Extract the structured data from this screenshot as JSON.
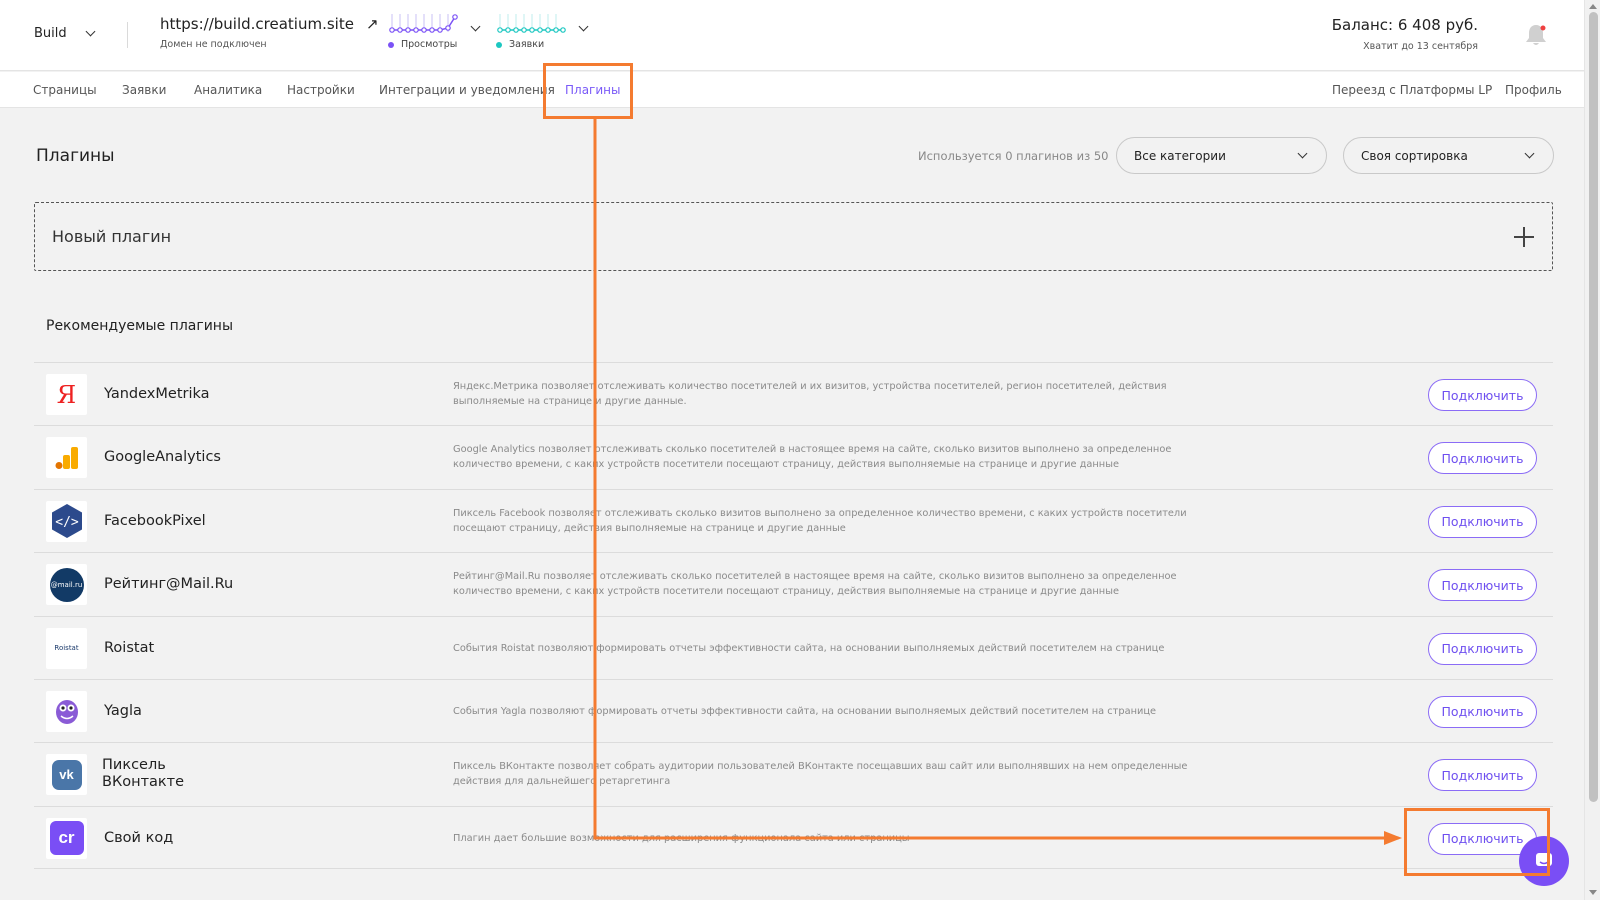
{
  "header": {
    "project": "Build",
    "domain_url": "https://build.creatium.site",
    "domain_status": "Домен не подключен",
    "stats": [
      {
        "label": "Просмотры",
        "color": "#7b52f6"
      },
      {
        "label": "Заявки",
        "color": "#1cc7c1"
      }
    ],
    "balance": "Баланс: 6 408 руб.",
    "balance_note": "Хватит до 13 сентября"
  },
  "nav": {
    "left": [
      "Страницы",
      "Заявки",
      "Аналитика",
      "Настройки",
      "Интеграции и уведомления",
      "Плагины"
    ],
    "right": [
      "Переезд с Платформы LP",
      "Профиль"
    ],
    "active": "Плагины"
  },
  "page": {
    "title": "Плагины",
    "usage": "Используется 0 плагинов из 50",
    "category_select": "Все категории",
    "sort_select": "Своя сортировка",
    "new_plugin": "Новый плагин",
    "recommended_title": "Рекомендуемые плагины"
  },
  "plugins": [
    {
      "name": "YandexMetrika",
      "icon": "yandex-metrika-icon",
      "description": "Яндекс.Метрика позволяет отслеживать количество посетителей и их визитов, устройства посетителей, регион посетителей, действия выполняемые на странице и другие данные.",
      "button": "Подключить"
    },
    {
      "name": "GoogleAnalytics",
      "icon": "google-analytics-icon",
      "description": "Google Analytics позволяет отслеживать сколько посетителей в настоящее время на сайте, сколько визитов выполнено за определенное количество времени, с каких устройств посетители посещают страницу, действия выполняемые на странице и другие данные",
      "button": "Подключить"
    },
    {
      "name": "FacebookPixel",
      "icon": "facebook-pixel-icon",
      "description": "Пиксель Facebook позволяет отслеживать сколько визитов выполнено за определенное количество времени, с каких устройств посетители посещают страницу, действия выполняемые на странице и другие данные",
      "button": "Подключить"
    },
    {
      "name": "Рейтинг@Mail.Ru",
      "icon": "mail-ru-icon",
      "icon_text": "@mail.ru",
      "description": "Рейтинг@Mail.Ru позволяет отслеживать сколько посетителей в настоящее время на сайте, сколько визитов выполнено за определенное количество времени, с каких устройств посетители посещают страницу, действия выполняемые на странице и другие данные",
      "button": "Подключить"
    },
    {
      "name": "Roistat",
      "icon": "roistat-icon",
      "icon_text": "Roistat",
      "description": "События Roistat позволяют формировать отчеты эффективности сайта, на основании выполняемых действий посетителем на странице",
      "button": "Подключить"
    },
    {
      "name": "Yagla",
      "icon": "yagla-icon",
      "description": "События Yagla позволяют формировать отчеты эффективности сайта, на основании выполняемых действий посетителем на странице",
      "button": "Подключить"
    },
    {
      "name": "Пиксель ВКонтакте",
      "icon": "vk-icon",
      "description": "Пиксель ВКонтакте позволяет собрать аудитории пользователей ВКонтакте посещавших ваш сайт или выполнявших на нем определенные действия для дальнейшего ретаргетинга",
      "button": "Подключить"
    },
    {
      "name": "Свой код",
      "icon": "custom-code-icon",
      "description": "Плагин дает большие возможности для расширения функционала сайта или страницы",
      "button": "Подключить"
    }
  ],
  "colors": {
    "accent": "#7a5af8",
    "annotation": "#f47b30"
  }
}
